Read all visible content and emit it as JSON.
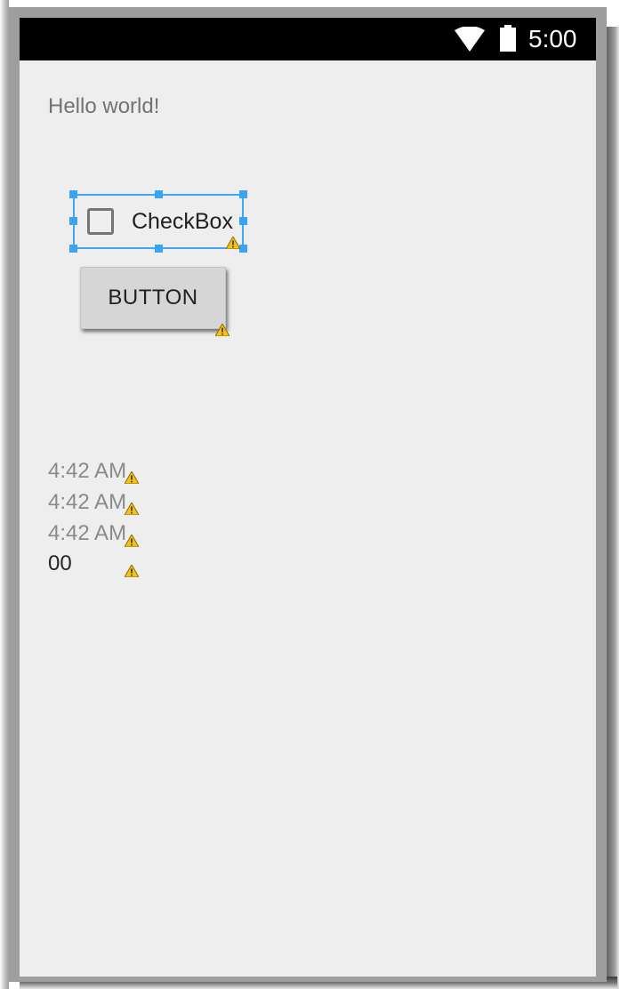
{
  "status_bar": {
    "time": "5:00",
    "icons": [
      "wifi-icon",
      "battery-icon"
    ],
    "background": "#000000"
  },
  "screen": {
    "background": "#eeeeee",
    "hello_text": "Hello world!",
    "checkbox": {
      "label": "CheckBox",
      "checked": false,
      "selected_in_designer": true,
      "selection_color": "#3ba3f4"
    },
    "button": {
      "label": "BUTTON"
    },
    "clock_lines": [
      "4:42 AM",
      "4:42 AM",
      "4:42 AM"
    ],
    "number_line": "00",
    "warning_icon": "warning-icon"
  }
}
